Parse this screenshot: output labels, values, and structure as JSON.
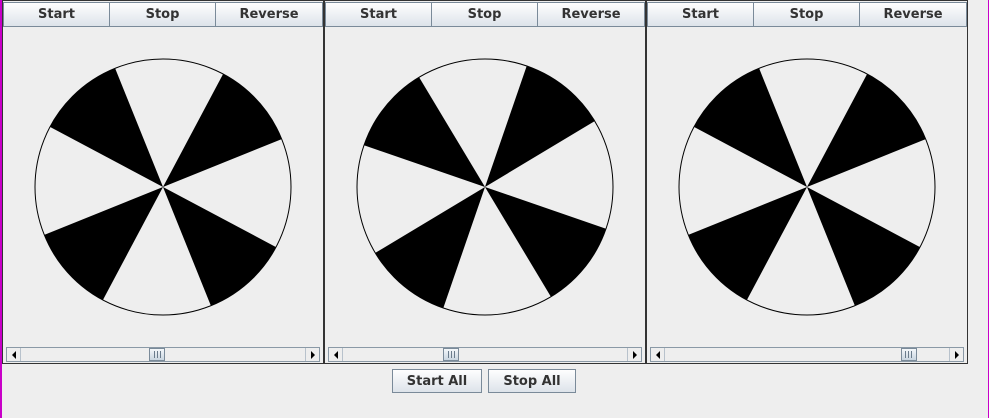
{
  "panels": [
    {
      "buttons": [
        "Start",
        "Stop",
        "Reverse"
      ],
      "fan": {
        "angle_deg": -3,
        "blade_count": 4,
        "blade_color": "#000000"
      },
      "scroll": {
        "position": 0.48
      }
    },
    {
      "buttons": [
        "Start",
        "Stop",
        "Reverse"
      ],
      "fan": {
        "angle_deg": 6,
        "blade_count": 4,
        "blade_color": "#000000"
      },
      "scroll": {
        "position": 0.38
      }
    },
    {
      "buttons": [
        "Start",
        "Stop",
        "Reverse"
      ],
      "fan": {
        "angle_deg": -3,
        "blade_count": 4,
        "blade_color": "#000000"
      },
      "scroll": {
        "position": 0.86
      }
    }
  ],
  "controls": {
    "start_all": "Start All",
    "stop_all": "Stop All"
  },
  "colors": {
    "background": "#eeeeee",
    "frame_edge": "#c800c8"
  }
}
